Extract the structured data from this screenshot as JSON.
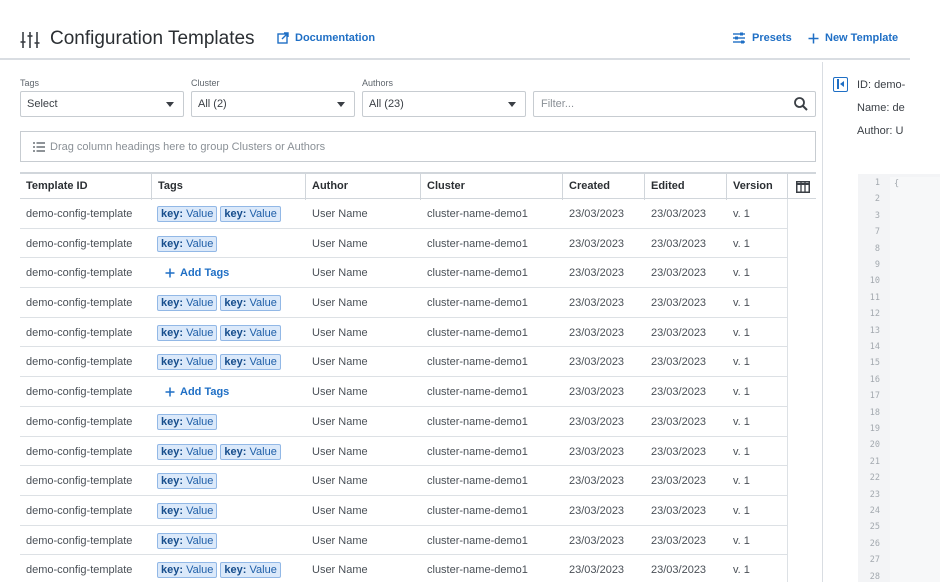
{
  "header": {
    "title": "Configuration Templates",
    "documentation_label": "Documentation",
    "presets_label": "Presets",
    "new_template_label": "New Template"
  },
  "filters": {
    "tags": {
      "label": "Tags",
      "value": "Select"
    },
    "cluster": {
      "label": "Cluster",
      "value": "All (2)"
    },
    "authors": {
      "label": "Authors",
      "value": "All (23)"
    },
    "filter_placeholder": "Filter..."
  },
  "group_bar": {
    "text": "Drag column headings here to group Clusters or Authors"
  },
  "table": {
    "columns": [
      "Template ID",
      "Tags",
      "Author",
      "Cluster",
      "Created",
      "Edited",
      "Version"
    ],
    "add_tags_label": "Add Tags",
    "tag_key": "key:",
    "tag_value": "Value",
    "rows": [
      {
        "id": "demo-config-template",
        "tags": 2,
        "author": "User Name",
        "cluster": "cluster-name-demo1",
        "created": "23/03/2023",
        "edited": "23/03/2023",
        "version": "v. 1"
      },
      {
        "id": "demo-config-template",
        "tags": 1,
        "author": "User Name",
        "cluster": "cluster-name-demo1",
        "created": "23/03/2023",
        "edited": "23/03/2023",
        "version": "v. 1"
      },
      {
        "id": "demo-config-template",
        "tags": 0,
        "author": "User Name",
        "cluster": "cluster-name-demo1",
        "created": "23/03/2023",
        "edited": "23/03/2023",
        "version": "v. 1"
      },
      {
        "id": "demo-config-template",
        "tags": 2,
        "author": "User Name",
        "cluster": "cluster-name-demo1",
        "created": "23/03/2023",
        "edited": "23/03/2023",
        "version": "v. 1"
      },
      {
        "id": "demo-config-template",
        "tags": 2,
        "author": "User Name",
        "cluster": "cluster-name-demo1",
        "created": "23/03/2023",
        "edited": "23/03/2023",
        "version": "v. 1"
      },
      {
        "id": "demo-config-template",
        "tags": 2,
        "author": "User Name",
        "cluster": "cluster-name-demo1",
        "created": "23/03/2023",
        "edited": "23/03/2023",
        "version": "v. 1"
      },
      {
        "id": "demo-config-template",
        "tags": 0,
        "author": "User Name",
        "cluster": "cluster-name-demo1",
        "created": "23/03/2023",
        "edited": "23/03/2023",
        "version": "v. 1"
      },
      {
        "id": "demo-config-template",
        "tags": 1,
        "author": "User Name",
        "cluster": "cluster-name-demo1",
        "created": "23/03/2023",
        "edited": "23/03/2023",
        "version": "v. 1"
      },
      {
        "id": "demo-config-template",
        "tags": 2,
        "author": "User Name",
        "cluster": "cluster-name-demo1",
        "created": "23/03/2023",
        "edited": "23/03/2023",
        "version": "v. 1"
      },
      {
        "id": "demo-config-template",
        "tags": 1,
        "author": "User Name",
        "cluster": "cluster-name-demo1",
        "created": "23/03/2023",
        "edited": "23/03/2023",
        "version": "v. 1"
      },
      {
        "id": "demo-config-template",
        "tags": 1,
        "author": "User Name",
        "cluster": "cluster-name-demo1",
        "created": "23/03/2023",
        "edited": "23/03/2023",
        "version": "v. 1"
      },
      {
        "id": "demo-config-template",
        "tags": 1,
        "author": "User Name",
        "cluster": "cluster-name-demo1",
        "created": "23/03/2023",
        "edited": "23/03/2023",
        "version": "v. 1"
      },
      {
        "id": "demo-config-template",
        "tags": 2,
        "author": "User Name",
        "cluster": "cluster-name-demo1",
        "created": "23/03/2023",
        "edited": "23/03/2023",
        "version": "v. 1"
      }
    ]
  },
  "details_panel": {
    "id_line": "ID: demo-",
    "name_line": "Name: de",
    "author_line": "Author: U",
    "first_code_glyph": "{",
    "line_numbers": [
      "1",
      "2",
      "3",
      "7",
      "8",
      "9",
      "10",
      "11",
      "12",
      "13",
      "14",
      "15",
      "16",
      "17",
      "18",
      "19",
      "20",
      "21",
      "22",
      "23",
      "24",
      "25",
      "26",
      "27",
      "28"
    ]
  },
  "colors": {
    "accent": "#1f6fc5",
    "tag_bg": "#dbe9fa",
    "tag_border": "#92b8e6",
    "border": "#d1d6db",
    "text": "#3a3f45"
  }
}
